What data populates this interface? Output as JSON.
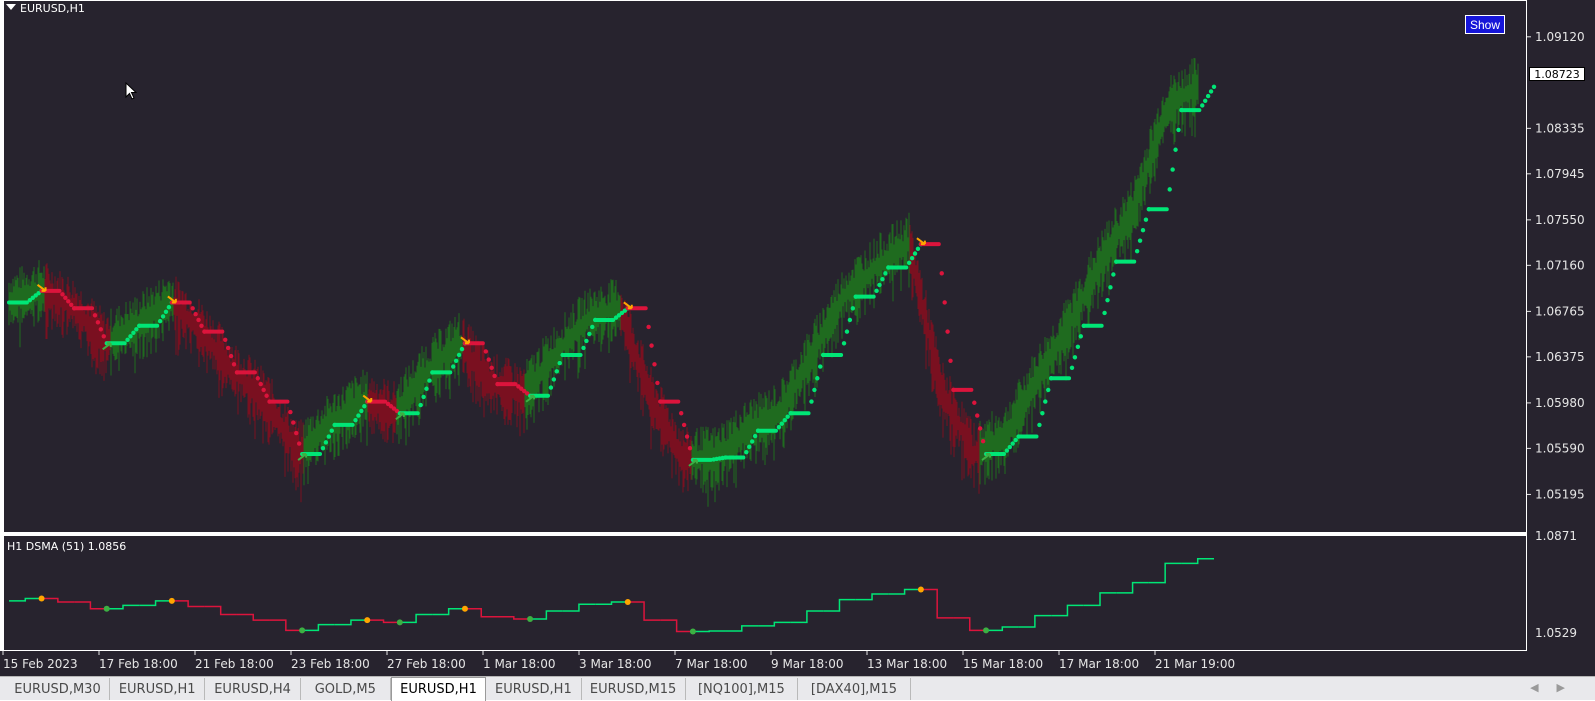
{
  "window": {
    "title": "EURUSD,H1",
    "show_button": "Show",
    "current_price": "1.08723"
  },
  "price_axis": [
    "1.09120",
    "1.08335",
    "1.07945",
    "1.07550",
    "1.07160",
    "1.06765",
    "1.06375",
    "1.05980",
    "1.05590",
    "1.05195"
  ],
  "indicator": {
    "title": "H1 DSMA (51) 1.0856",
    "axis_top": "1.0871",
    "axis_bottom": "1.0529"
  },
  "time_axis": [
    "15 Feb 2023",
    "17 Feb 18:00",
    "21 Feb 18:00",
    "23 Feb 18:00",
    "27 Feb 18:00",
    "1 Mar 18:00",
    "3 Mar 18:00",
    "7 Mar 18:00",
    "9 Mar 18:00",
    "13 Mar 18:00",
    "15 Mar 18:00",
    "17 Mar 18:00",
    "21 Mar 19:00"
  ],
  "tabs": [
    "EURUSD,M30",
    "EURUSD,H1",
    "EURUSD,H4",
    "GOLD,M5",
    "EURUSD,H1",
    "EURUSD,H1",
    "EURUSD,M15",
    "[NQ100],M15",
    "[DAX40],M15"
  ],
  "active_tab": 4,
  "colors": {
    "background": "#27232e",
    "bull": "#00e676",
    "bear": "#dc143c",
    "bull_bars": "#1f6b1f",
    "bear_bars": "#7a1020",
    "signal_up": "#3cb043",
    "signal_down": "#ffa500",
    "show_button": "#1515d8"
  },
  "chart_data": {
    "type": "line",
    "symbol": "EURUSD,H1",
    "ylim": [
      1.0495,
      1.0935
    ],
    "x": [
      "15 Feb 2023",
      "17 Feb 18:00",
      "21 Feb 18:00",
      "23 Feb 18:00",
      "27 Feb 18:00",
      "1 Mar 18:00",
      "3 Mar 18:00",
      "7 Mar 18:00",
      "9 Mar 18:00",
      "13 Mar 18:00",
      "15 Mar 18:00",
      "17 Mar 18:00",
      "21 Mar 19:00"
    ],
    "series": [
      {
        "values": [
          1.0685,
          1.0695,
          1.068,
          1.065,
          1.0665,
          1.0685,
          1.066,
          1.0625,
          1.06,
          1.0555,
          1.058,
          1.06,
          1.059,
          1.0625,
          1.065,
          1.0615,
          1.0605,
          1.064,
          1.067,
          1.068,
          1.06,
          1.055,
          1.0552,
          1.0575,
          1.059,
          1.064,
          1.069,
          1.0715,
          1.0735,
          1.061,
          1.0555,
          1.057,
          1.062,
          1.0665,
          1.072,
          1.0765,
          1.085,
          1.087
        ]
      }
    ]
  }
}
